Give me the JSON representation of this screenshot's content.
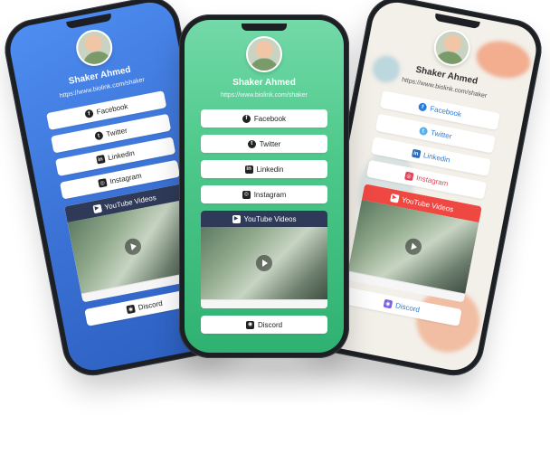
{
  "profile": {
    "name": "Shaker Ahmed",
    "url": "https://www.biolink.com/shaker"
  },
  "links": {
    "facebook": "Facebook",
    "twitter": "Twitter",
    "linkedin": "Linkedin",
    "instagram": "Instagram",
    "youtube": "YouTube Videos",
    "discord": "Discord"
  },
  "icons": {
    "facebook": "facebook-icon",
    "twitter": "twitter-icon",
    "linkedin": "linkedin-icon",
    "instagram": "instagram-icon",
    "youtube": "youtube-icon",
    "discord": "discord-icon"
  },
  "themes": {
    "left": "#3c73d6",
    "center": "#4ec98b",
    "right": "#f3efe9",
    "youtube_dark": "#2e3a58",
    "youtube_red": "#ef4741"
  }
}
